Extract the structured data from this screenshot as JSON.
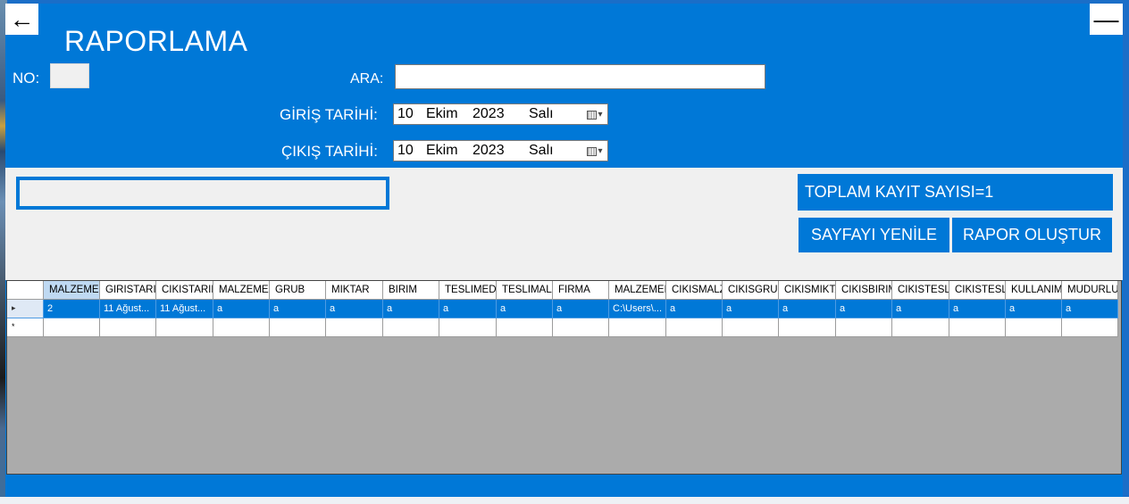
{
  "window": {
    "title": "RAPORLAMA",
    "back_icon": "←",
    "minimize_icon": "—"
  },
  "form": {
    "no_label": "NO:",
    "no_value": "",
    "search_label": "ARA:",
    "search_value": "",
    "entry_date_label": "GİRİŞ TARİHİ:",
    "entry_date": {
      "day": "10",
      "month": "Ekim",
      "year": "2023",
      "weekday": "Salı"
    },
    "exit_date_label": "ÇIKIŞ TARİHİ:",
    "exit_date": {
      "day": "10",
      "month": "Ekim",
      "year": "2023",
      "weekday": "Salı"
    }
  },
  "panel": {
    "count_label": "TOPLAM KAYIT SAYISI=1",
    "refresh_button": "SAYFAYI YENİLE",
    "report_button": "RAPOR OLUŞTUR"
  },
  "grid": {
    "columns": [
      "MALZEMEI",
      "GIRISTARI",
      "CIKISTARIH",
      "MALZEMEA",
      "GRUB",
      "MIKTAR",
      "BIRIM",
      "TESLIMED",
      "TESLIMALA",
      "FIRMA",
      "MALZEMEF",
      "CIKISMALZ",
      "CIKISGRUE",
      "CIKISMIKTA",
      "CIKISBIRIM",
      "CIKISTESL",
      "CIKISTESL",
      "KULLANIM",
      "MUDURLU"
    ],
    "rows": [
      [
        "2",
        "11 Ağust...",
        "11 Ağust...",
        "a",
        "a",
        "a",
        "a",
        "a",
        "a",
        "a",
        "C:\\Users\\...",
        "a",
        "a",
        "a",
        "a",
        "a",
        "a",
        "a",
        "a"
      ]
    ],
    "current_row_marker": "▸",
    "new_row_marker": "*"
  },
  "colors": {
    "accent": "#0078d7",
    "panel_bg": "#f0f0f0",
    "grid_empty": "#ababab"
  }
}
